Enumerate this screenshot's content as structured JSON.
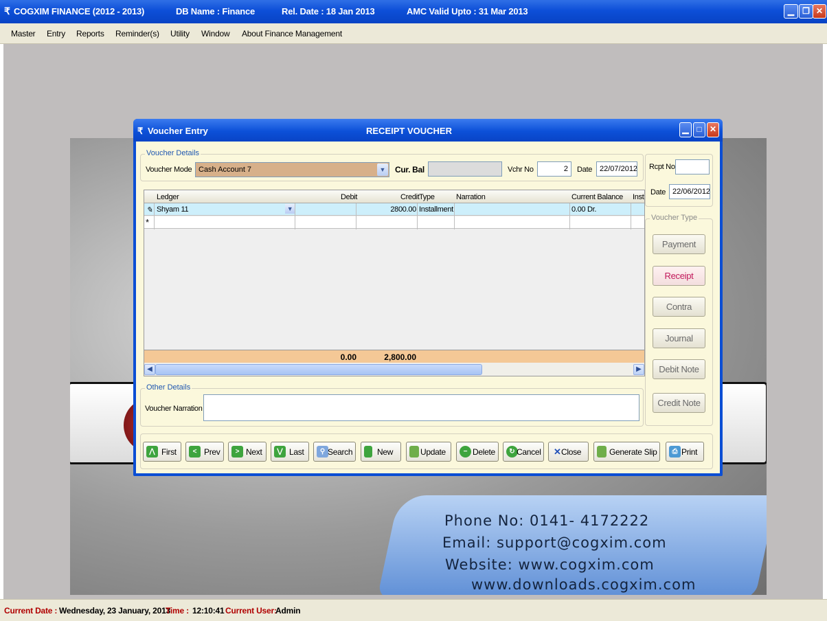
{
  "app": {
    "name": "COGXIM FINANCE  (2012 - 2013)",
    "db": "DB Name : Finance",
    "rel_date": "Rel. Date : 18 Jan 2013",
    "amc": "AMC Valid Upto : 31 Mar 2013"
  },
  "menu": [
    "Master",
    "Entry",
    "Reports",
    "Reminder(s)",
    "Utility",
    "Window",
    "About Finance Management"
  ],
  "splash": {
    "phone": "Phone No:   0141- 4172222",
    "email": "Email:  support@cogxim.com",
    "website": "Website:   www.cogxim.com",
    "downloads": "www.downloads.cogxim.com"
  },
  "voucher": {
    "window_title": "Voucher Entry",
    "voucher_name": "RECEIPT  VOUCHER",
    "details_legend": "Voucher Details",
    "mode_label": "Voucher Mode",
    "mode_value": "Cash Account  7",
    "cur_bal_label": "Cur. Bal",
    "cur_bal_value": "",
    "vchr_no_label": "Vchr No",
    "vchr_no_value": "2",
    "date_label": "Date",
    "date_value": "22/07/2012",
    "rcpt_no_label": "Rcpt No",
    "rcpt_no_value": "",
    "rcpt_date_label": "Date",
    "rcpt_date_value": "22/06/2012",
    "grid": {
      "headers": {
        "ledger": "Ledger",
        "debit": "Debit",
        "credit": "Credit",
        "type": "Type",
        "narration": "Narration",
        "current_balance": "Current Balance",
        "inst": "Inst"
      },
      "rows": [
        {
          "marker": "✎",
          "ledger": "Shyam  11",
          "debit": "",
          "credit": "2800.00",
          "type": "Installment",
          "narration": "",
          "current_balance": "0.00  Dr."
        }
      ],
      "new_row_marker": "*",
      "total_debit": "0.00",
      "total_credit": "2,800.00"
    },
    "voucher_type_legend": "Voucher Type",
    "voucher_types": [
      "Payment",
      "Receipt",
      "Contra",
      "Journal",
      "Debit Note",
      "Credit Note"
    ],
    "selected_type": "Receipt",
    "other_details_legend": "Other Details",
    "narration_label": "Voucher Narration",
    "narration_value": "",
    "buttons": [
      "First",
      "Prev",
      "Next",
      "Last",
      "Search",
      "New",
      "Update",
      "Delete",
      "Cancel",
      "Close",
      "Generate Slip",
      "Print"
    ]
  },
  "status": {
    "date_label": "Current Date :",
    "date_value": "Wednesday, 23 January, 2013",
    "time_label": "Time :",
    "time_value": "12:10:41",
    "user_label": "Current User:",
    "user_value": "Admin"
  },
  "colors": {
    "titlebar": "#0d4fd8",
    "panel": "#fbf8dc",
    "combo": "#d7b08a",
    "grid_selected": "#cdeffb",
    "totals_row": "#f4c896",
    "status_label": "#b00000",
    "active_type": "#c2185b"
  },
  "icons": {
    "button_icons": [
      "up-arrow-icon",
      "left-arrow-icon",
      "right-arrow-icon",
      "down-arrow-icon",
      "search-icon",
      "new-document-icon",
      "save-icon",
      "delete-icon",
      "refresh-icon",
      "close-icon",
      "slip-icon",
      "printer-icon"
    ]
  }
}
